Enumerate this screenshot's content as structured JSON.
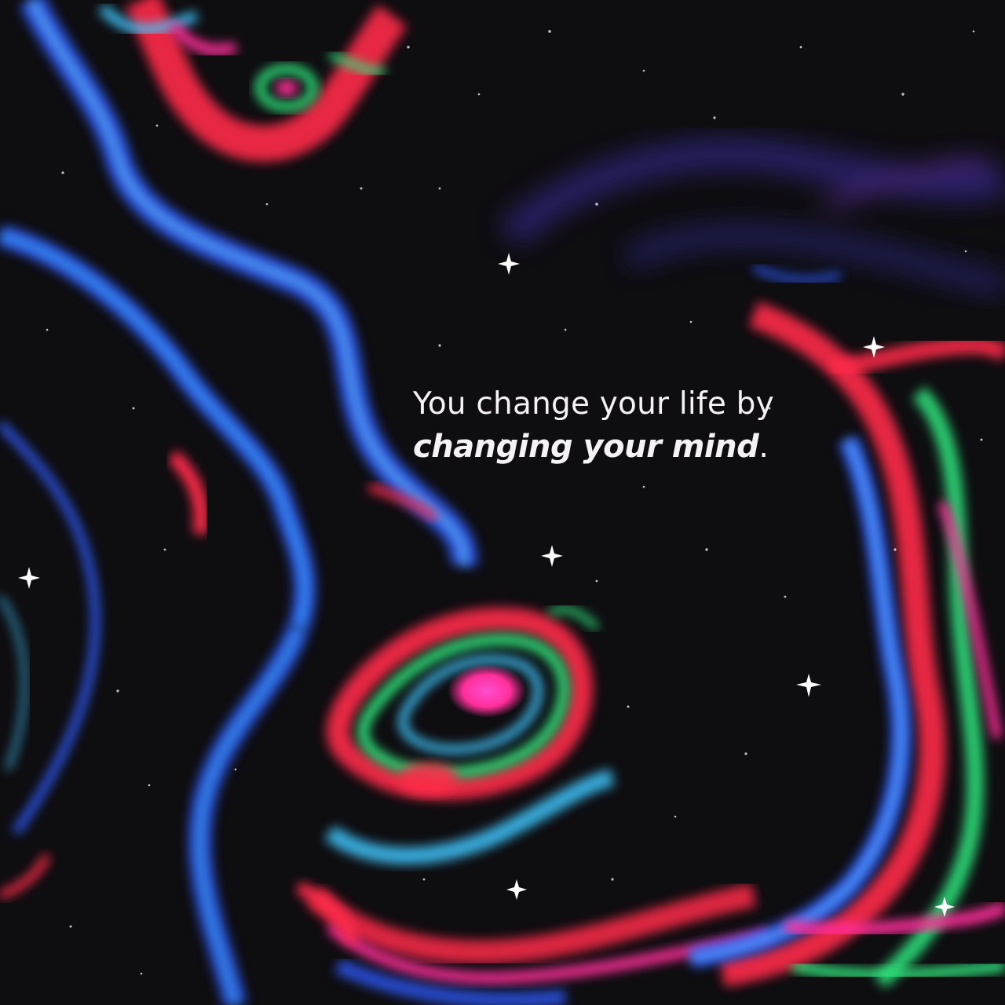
{
  "quote": {
    "line1": "You change your life by",
    "line2_emphasis": "changing your mind",
    "line2_suffix": "."
  },
  "colors": {
    "background": "#0e0d10",
    "text": "#f4f2f4",
    "blue": "#2f5bff",
    "cyan": "#3fc8ff",
    "red": "#ff2a4a",
    "magenta": "#ff2f9a",
    "green": "#2fe07a",
    "violet": "#5b3bd9"
  }
}
